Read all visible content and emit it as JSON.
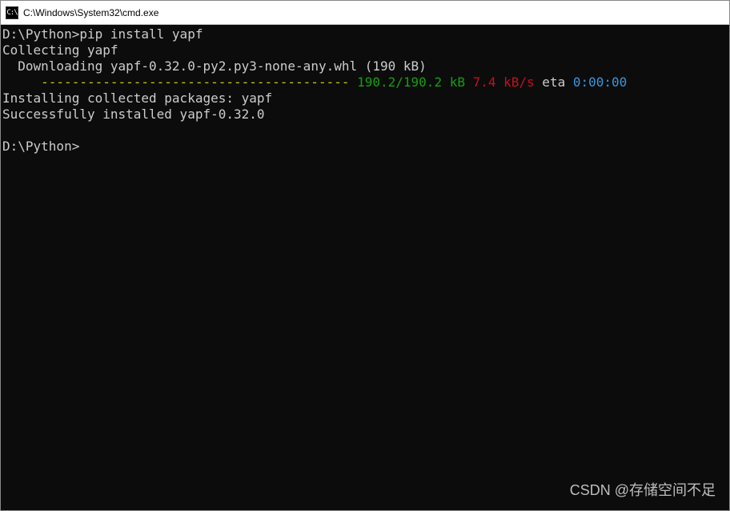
{
  "titlebar": {
    "icon_label": "C:\\",
    "title": "C:\\Windows\\System32\\cmd.exe"
  },
  "terminal": {
    "prompt1": "D:\\Python>",
    "command1": "pip install yapf",
    "line_collecting": "Collecting yapf",
    "line_downloading": "Downloading yapf-0.32.0-py2.py3-none-any.whl (190 kB)",
    "progress_dashes": "---------------------------------------- ",
    "progress_size": "190.2/190.2 kB",
    "progress_speed": " 7.4 kB/s",
    "progress_eta_label": " eta ",
    "progress_eta_time": "0:00:00",
    "line_installing": "Installing collected packages: yapf",
    "line_success": "Successfully installed yapf-0.32.0",
    "prompt2": "D:\\Python>"
  },
  "watermark": "CSDN @存储空间不足"
}
